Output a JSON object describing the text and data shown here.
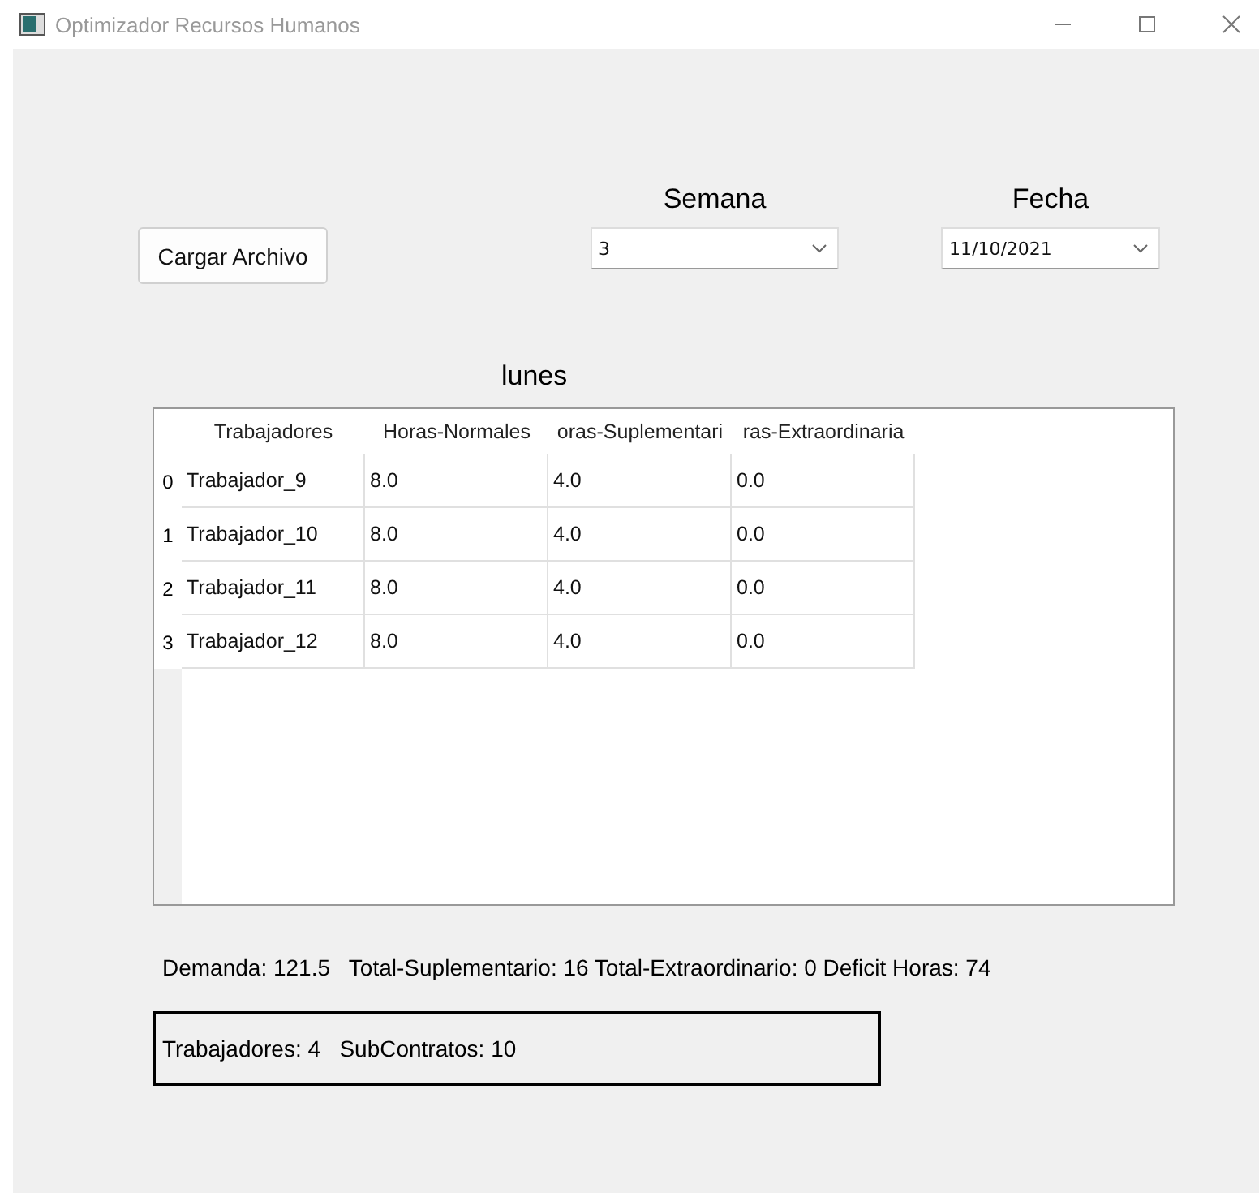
{
  "window": {
    "title": "Optimizador Recursos Humanos"
  },
  "load_button": "Cargar Archivo",
  "week": {
    "label": "Semana",
    "value": "3"
  },
  "date": {
    "label": "Fecha",
    "value": "11/10/2021"
  },
  "day": "lunes",
  "table": {
    "columns": [
      "Trabajadores",
      "Horas-Normales",
      "oras-Suplementari",
      "ras-Extraordinaria"
    ],
    "rows": [
      {
        "index": "0",
        "cells": [
          "Trabajador_9",
          "8.0",
          "4.0",
          "0.0"
        ]
      },
      {
        "index": "1",
        "cells": [
          "Trabajador_10",
          "8.0",
          "4.0",
          "0.0"
        ]
      },
      {
        "index": "2",
        "cells": [
          "Trabajador_11",
          "8.0",
          "4.0",
          "0.0"
        ]
      },
      {
        "index": "3",
        "cells": [
          "Trabajador_12",
          "8.0",
          "4.0",
          "0.0"
        ]
      }
    ]
  },
  "summary": "Demanda: 121.5   Total-Suplementario: 16 Total-Extraordinario: 0 Deficit Horas: 74",
  "totals": "Trabajadores: 4   SubContratos: 10"
}
